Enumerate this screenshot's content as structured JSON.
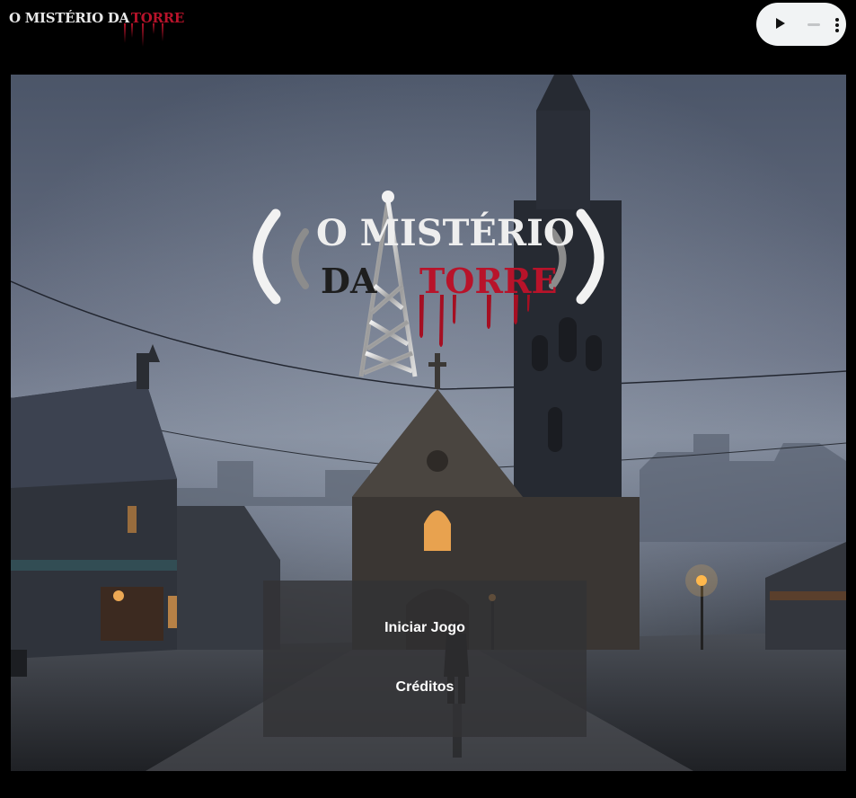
{
  "header": {
    "logo_text_a": "O MISTÉRIO DA",
    "logo_text_b": "TORRE"
  },
  "title_logo": {
    "line1": "O MISTÉRIO",
    "line2_a": "DA",
    "line2_b": "TORRE"
  },
  "menu": {
    "start_label": "Iniciar Jogo",
    "credits_label": "Créditos"
  },
  "audio_player": {
    "icons": [
      "play-icon",
      "volume-icon",
      "more-options-icon"
    ]
  },
  "colors": {
    "blood_red": "#b8132a",
    "silver": "#d9d9d9",
    "background": "#000000"
  }
}
